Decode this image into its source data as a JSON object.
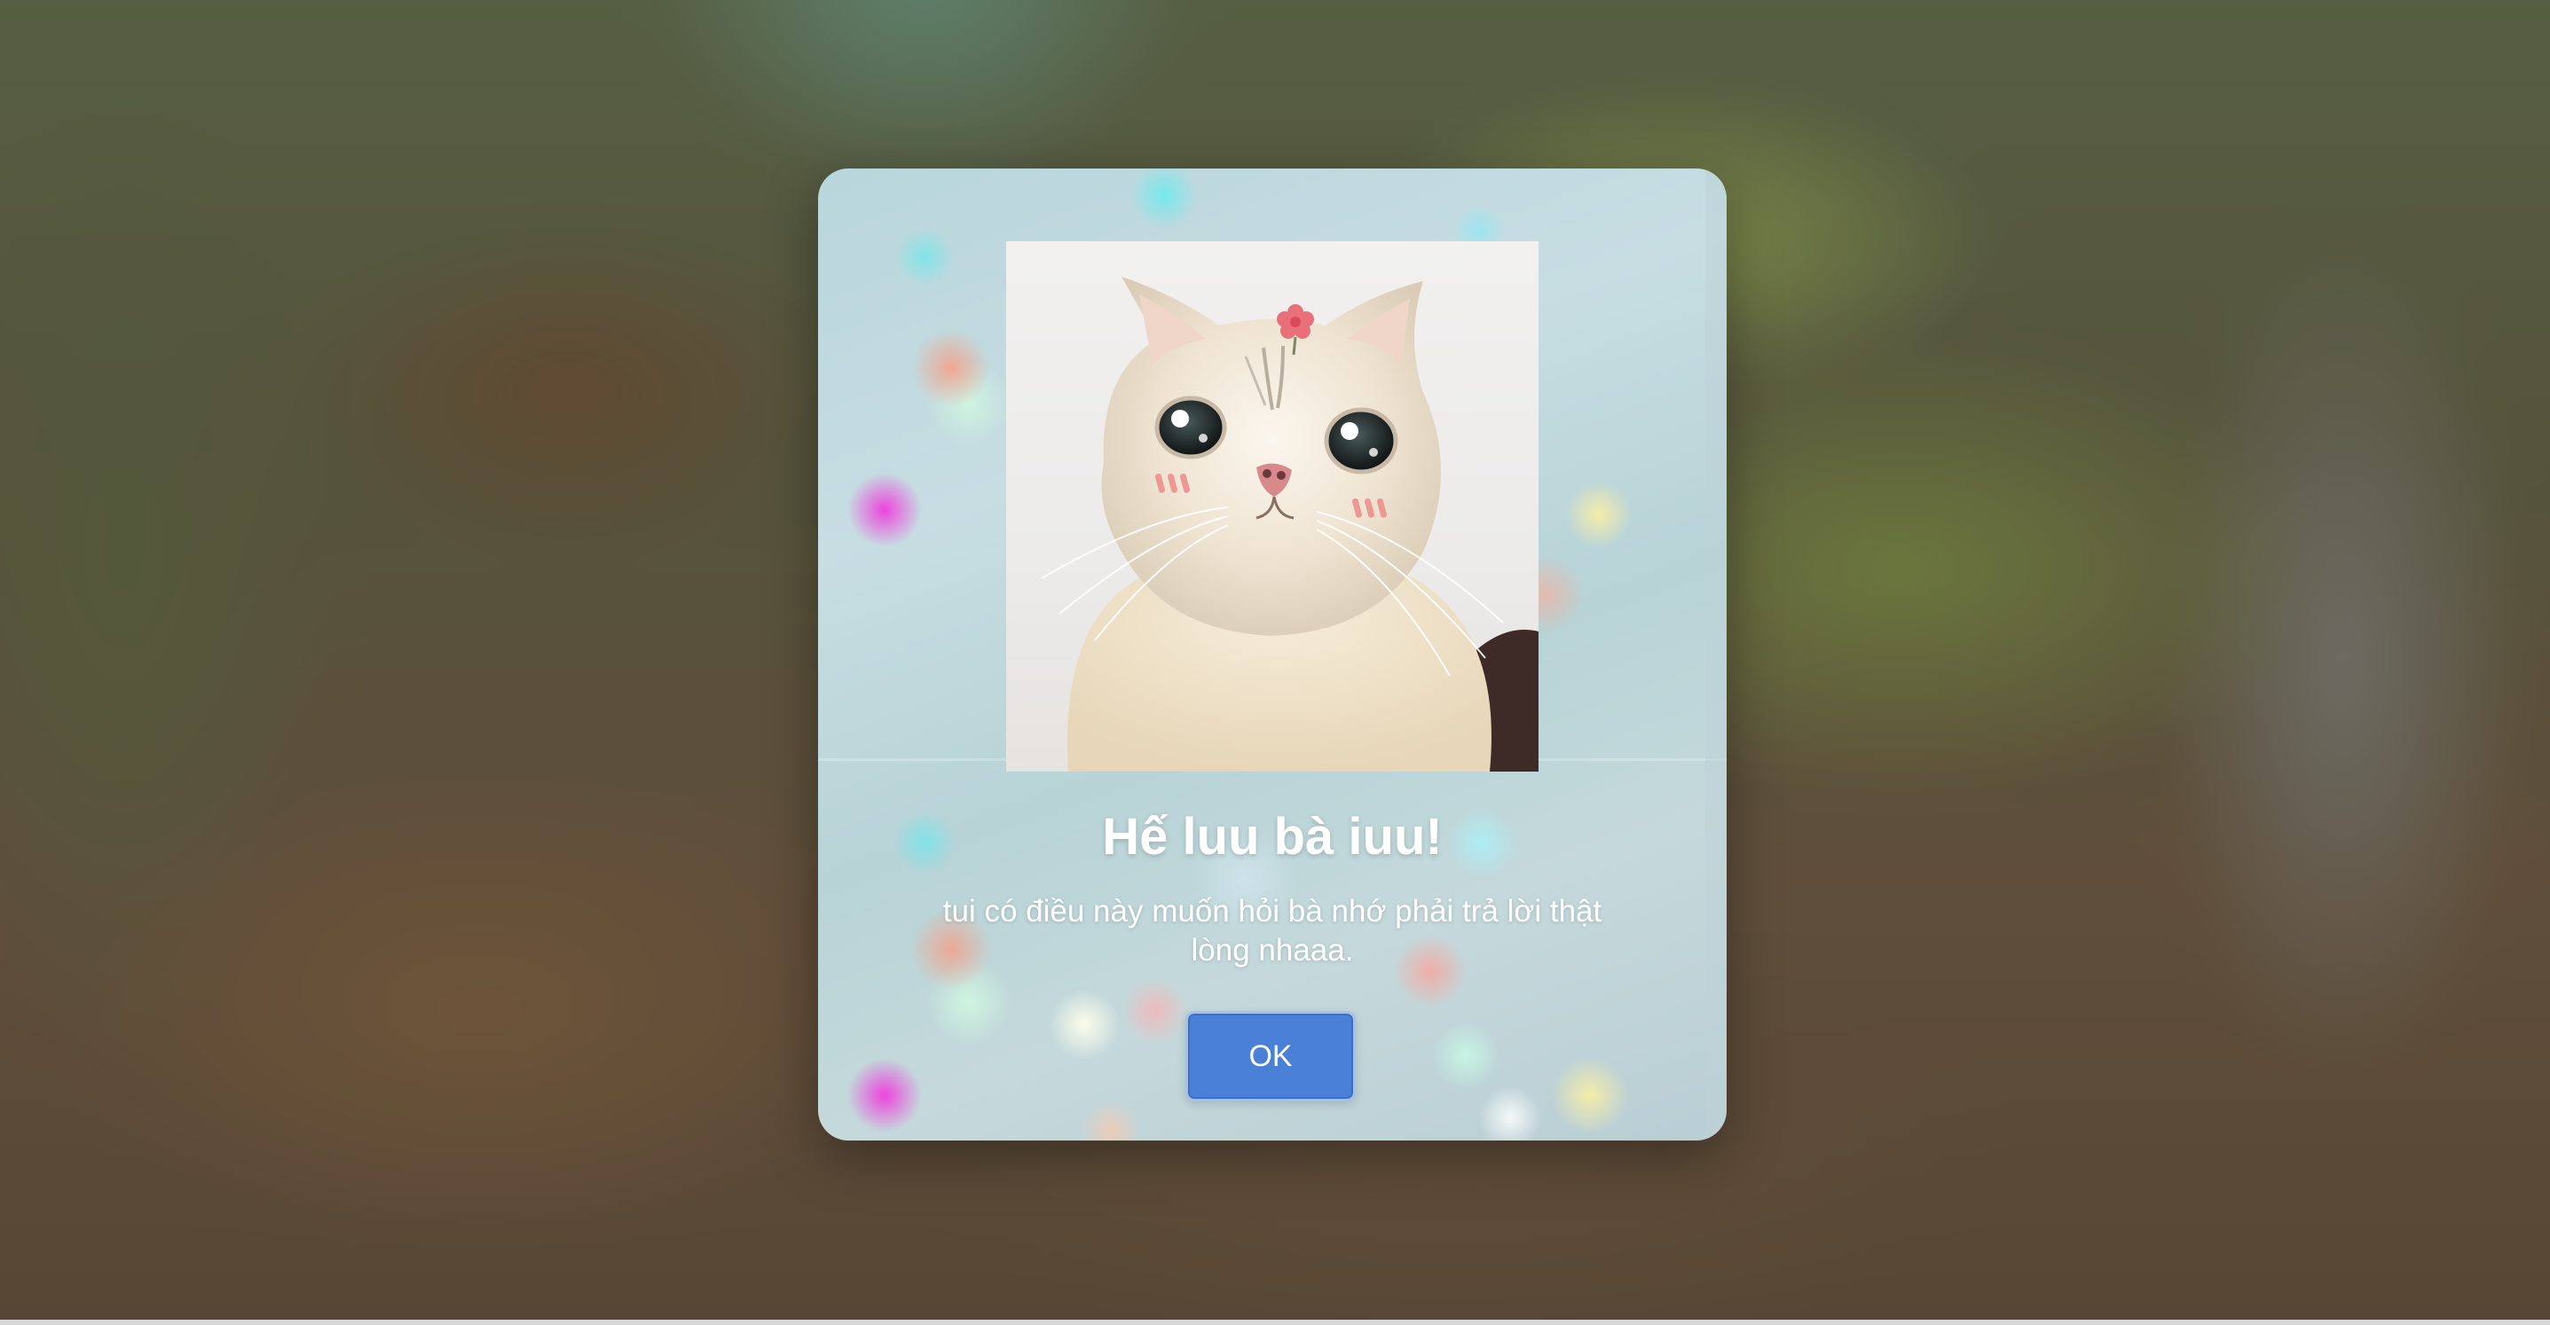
{
  "modal": {
    "title": "Hế luu bà iuu!",
    "message": "tui có điều này muốn hỏi bà nhớ phải trả lời thật lòng nhaaa.",
    "ok_button_label": "OK",
    "photo_subject": "cat-with-flower-image"
  },
  "colors": {
    "button_fill": "#4a81d6",
    "button_border": "#a9c0e6",
    "text": "#ffffff"
  }
}
